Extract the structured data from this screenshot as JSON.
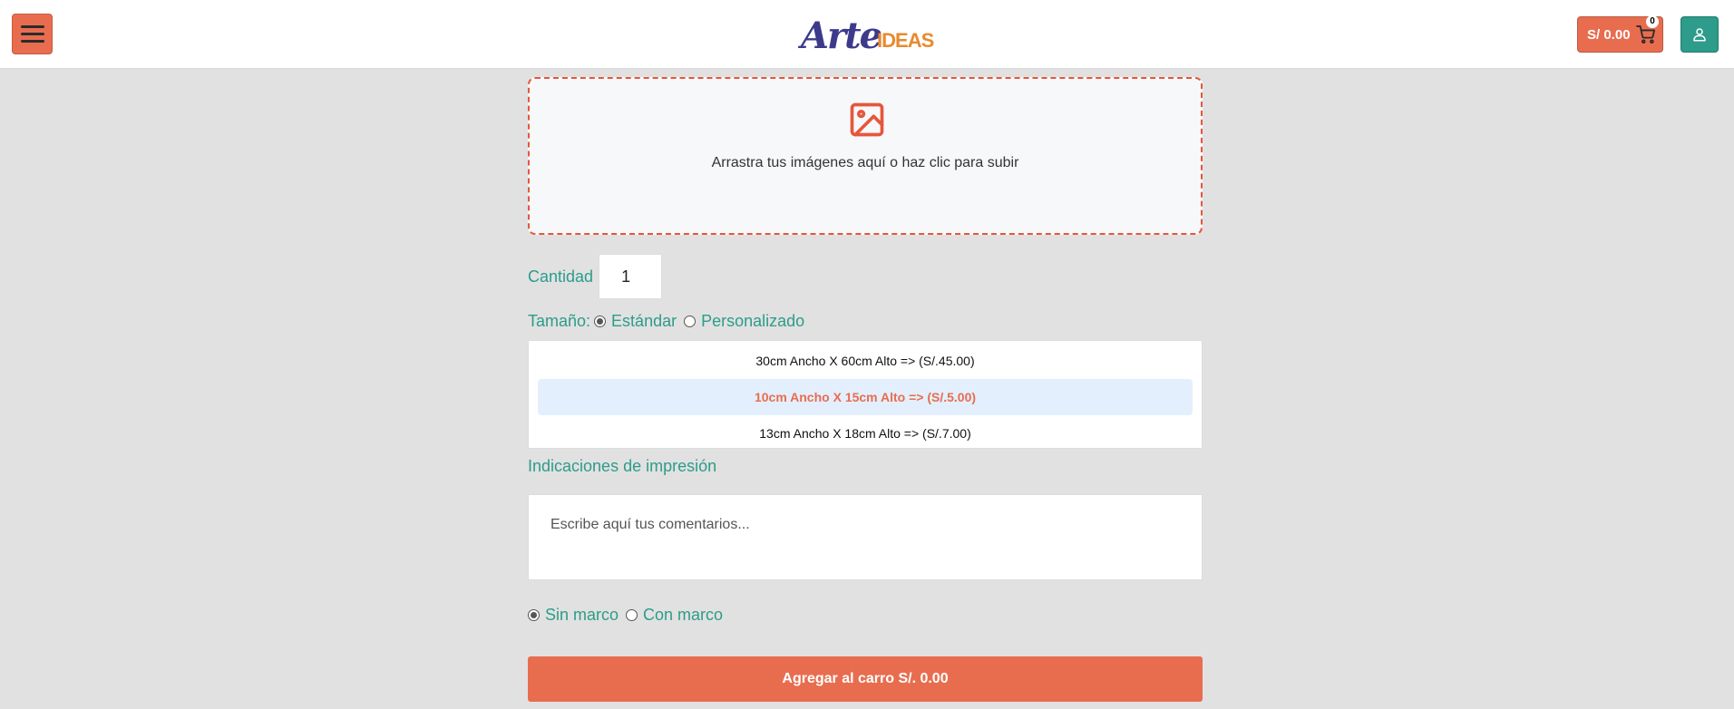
{
  "header": {
    "logo_main": "Arte",
    "logo_sub": "IDEAS",
    "cart_total": "S/ 0.00",
    "cart_count": "0"
  },
  "upload": {
    "text": "Arrastra tus imágenes aquí o haz clic para subir"
  },
  "quantity": {
    "label": "Cantidad",
    "value": "1"
  },
  "size": {
    "label": "Tamaño:",
    "options": [
      {
        "label": "Estándar",
        "checked": true
      },
      {
        "label": "Personalizado",
        "checked": false
      }
    ],
    "list": [
      {
        "text": "30cm Ancho X 60cm Alto => (S/.45.00)",
        "selected": false
      },
      {
        "text": "10cm Ancho X 15cm Alto => (S/.5.00)",
        "selected": true
      },
      {
        "text": "13cm Ancho X 18cm Alto => (S/.7.00)",
        "selected": false
      }
    ]
  },
  "notes": {
    "label": "Indicaciones de impresión",
    "placeholder": "Escribe aquí tus comentarios..."
  },
  "frame": {
    "options": [
      {
        "label": "Sin marco",
        "checked": true
      },
      {
        "label": "Con marco",
        "checked": false
      }
    ]
  },
  "add_button": {
    "label": "Agregar al carro S/. 0.00"
  },
  "colors": {
    "accent": "#e86d4f",
    "teal": "#2d9c8a",
    "selected_bg": "#e3effc",
    "logo_purple": "#3d3a8c",
    "logo_orange": "#e88a2e"
  }
}
